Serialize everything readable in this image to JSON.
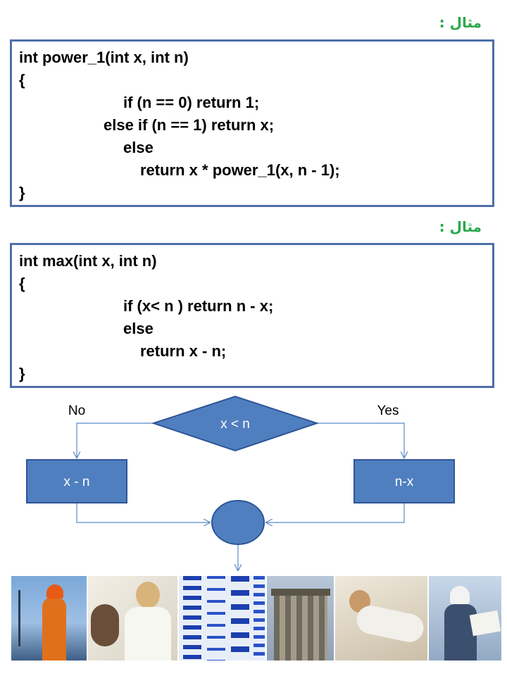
{
  "example1": {
    "label": "مثال :",
    "lines": [
      "int power_1(int x, int n)",
      "{",
      "if (n == 0) return 1;",
      "else if (n == 1) return x;",
      "else",
      "return x * power_1(x, n - 1);",
      "}"
    ]
  },
  "example2": {
    "label": "مثال :",
    "lines": [
      "int max(int x, int n)",
      "{",
      "if (x< n ) return n - x;",
      "else",
      "return x - n;",
      "}"
    ]
  },
  "flowchart": {
    "decision": "x < n",
    "no_label": "No",
    "yes_label": "Yes",
    "left_box": "x - n",
    "right_box": "n-x",
    "colors": {
      "fill": "#4f7fbf",
      "stroke": "#2f5597",
      "line": "#5b89c4"
    }
  }
}
